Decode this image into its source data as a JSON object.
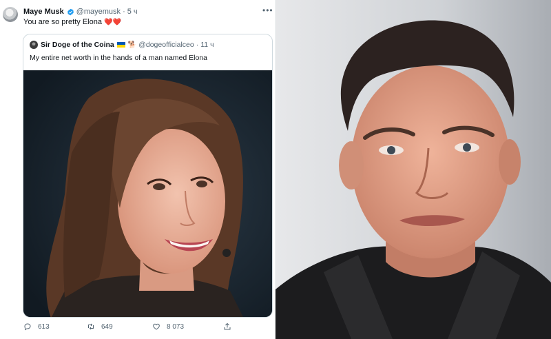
{
  "tweet": {
    "author_name": "Maye Musk",
    "handle": "@mayemusk",
    "separator": "·",
    "time": "5 ч",
    "text": "You are so pretty Elona",
    "emoji": "❤️❤️",
    "more_icon": "more-horizontal-icon"
  },
  "quoted_tweet": {
    "author_name": "Sir Doge of the Coina",
    "flag_emoji": "🇺🇦",
    "dog_emoji": "🐕",
    "handle": "@dogeofficialceo",
    "separator": "·",
    "time": "11 ч",
    "text": "My entire net worth in the hands of a man named Elona"
  },
  "actions": {
    "replies": "613",
    "retweets": "649",
    "likes": "8 073"
  },
  "colors": {
    "verified_blue": "#1d9bf0",
    "text_primary": "#0f1419",
    "text_secondary": "#536471",
    "border": "#cfd9de"
  }
}
